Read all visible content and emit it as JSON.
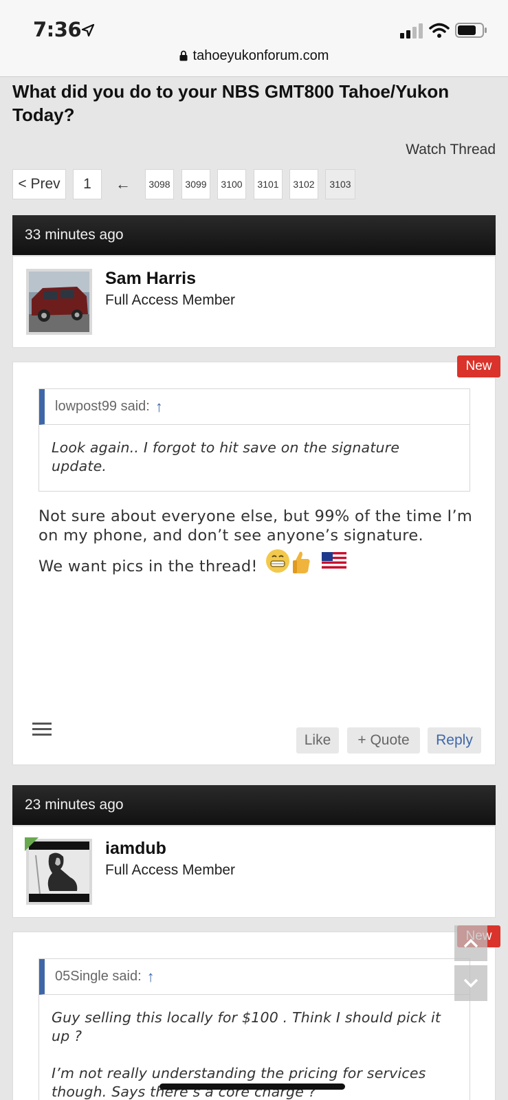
{
  "status_bar": {
    "time": "7:36",
    "url": "tahoeyukonforum.com"
  },
  "thread": {
    "title": "What did you do to your NBS GMT800 Tahoe/Yukon Today?",
    "watch_label": "Watch Thread"
  },
  "pagination": {
    "prev_label": "< Prev",
    "first_page": "1",
    "ellipsis_arrow": "←",
    "pages": [
      "3098",
      "3099",
      "3100",
      "3101",
      "3102",
      "3103"
    ],
    "current_page": "3103"
  },
  "posts": [
    {
      "time_ago": "33 minutes ago",
      "author": "Sam Harris",
      "role": "Full Access Member",
      "badge": "New",
      "quote_author": "lowpost99 said:",
      "quote_text": "Look again.. I forgot to hit save on the signature update.",
      "message_line1": "Not sure about everyone else, but 99% of the time I’m on my phone, and don’t see anyone’s signature.",
      "message_line2": "We want pics in the thread!",
      "actions": {
        "like": "Like",
        "quote": "+ Quote",
        "reply": "Reply"
      }
    },
    {
      "time_ago": "23 minutes ago",
      "author": "iamdub",
      "role": "Full Access Member",
      "badge": "New",
      "quote_author": "05Single said:",
      "quote_text_1": "Guy selling this locally for $100 . Think I should pick it up ?",
      "quote_text_2": "I’m not really understanding the pricing for services though. Says there’s a core charge ?"
    }
  ],
  "colors": {
    "badge_red": "#d9332b",
    "quote_blue": "#3f67a8",
    "header_bar": "#1a1a1a"
  }
}
